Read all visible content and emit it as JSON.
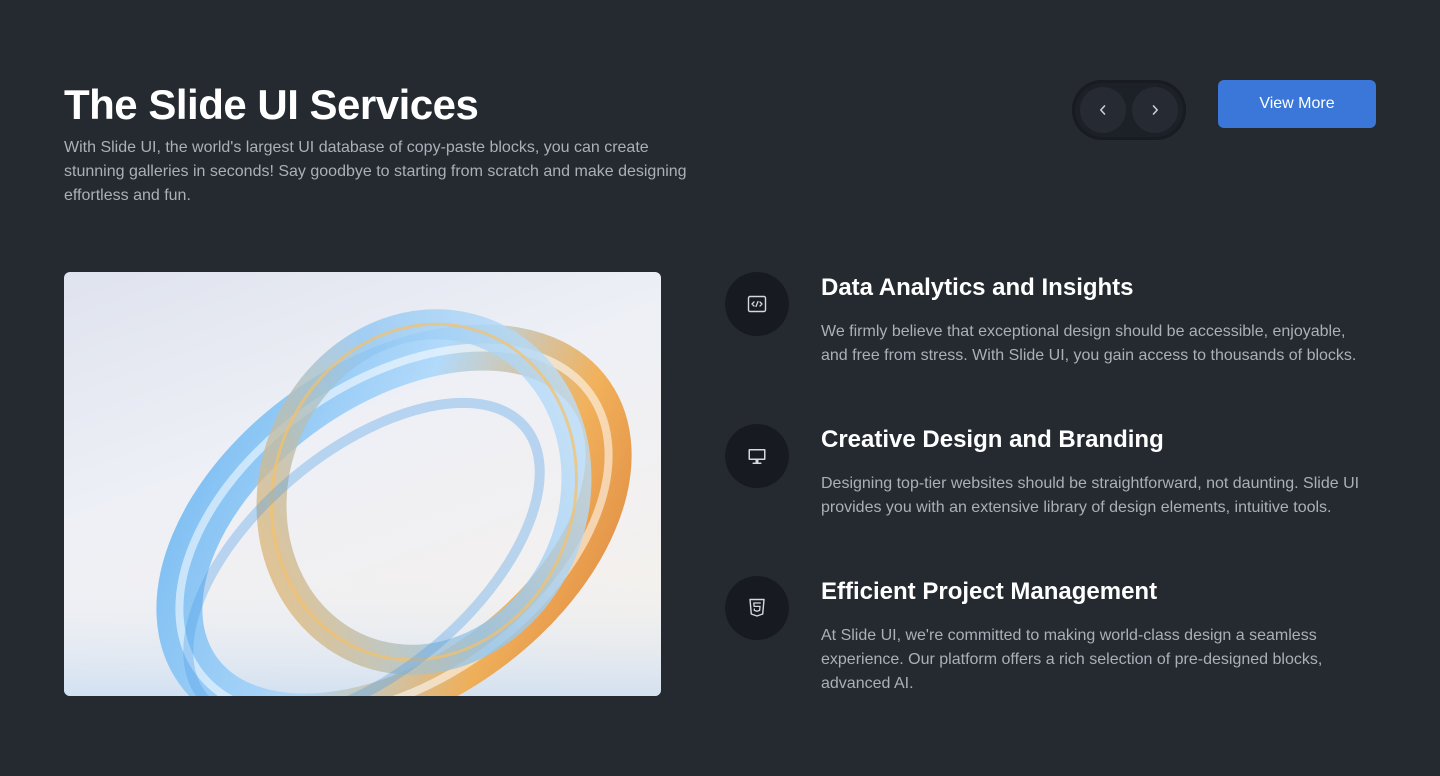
{
  "header": {
    "title": "The Slide UI Services",
    "subtitle": "With Slide UI, the world's largest UI database of copy-paste blocks, you can create stunning galleries in seconds! Say goodbye to starting from scratch and make designing effortless and fun."
  },
  "controls": {
    "prev_icon": "chevron-left-icon",
    "next_icon": "chevron-right-icon",
    "view_more_label": "View More"
  },
  "hero_image": {
    "subject": "abstract glass rings"
  },
  "services": [
    {
      "icon": "code-icon",
      "title": "Data Analytics and Insights",
      "description": "We firmly believe that exceptional design should be accessible, enjoyable, and free from stress. With Slide UI, you gain access to thousands of blocks."
    },
    {
      "icon": "monitor-icon",
      "title": "Creative Design and Branding",
      "description": "Designing top-tier websites should be straightforward, not daunting. Slide UI provides you with an extensive library of design elements, intuitive tools."
    },
    {
      "icon": "html5-icon",
      "title": "Efficient Project Management",
      "description": "At Slide UI, we're committed to making world-class design a seamless experience. Our platform offers a rich selection of pre-designed blocks, advanced AI."
    }
  ],
  "colors": {
    "background": "#252a31",
    "accent": "#3b77d8",
    "muted_text": "#aab0b8",
    "icon_circle": "#171b21"
  }
}
